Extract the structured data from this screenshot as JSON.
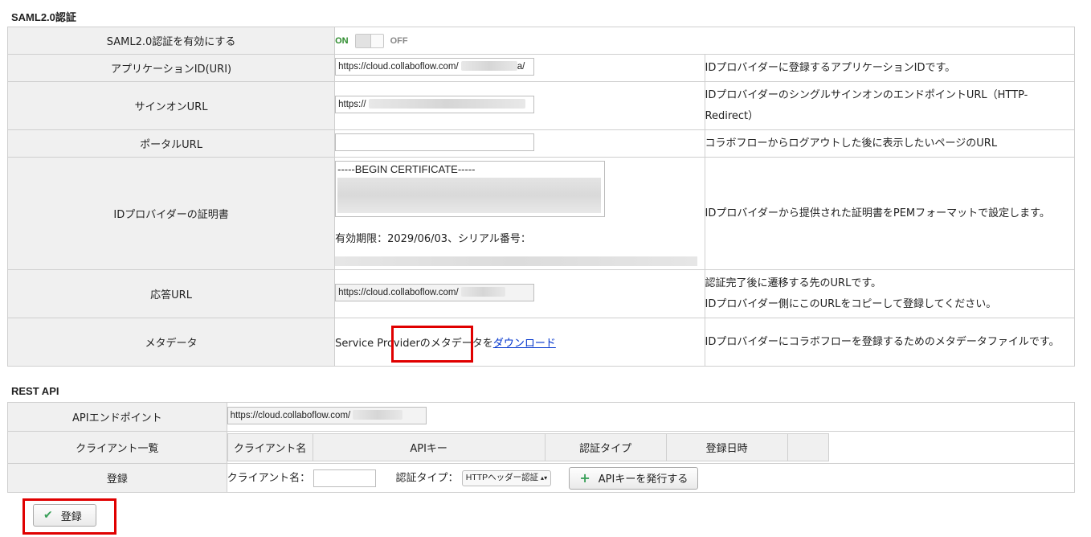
{
  "saml": {
    "title": "SAML2.0認証",
    "enable": {
      "label": "SAML2.0認証を有効にする",
      "on": "ON",
      "off": "OFF"
    },
    "app_id": {
      "label": "アプリケーションID(URI)",
      "value": "https://cloud.collaboflow.com/",
      "value_tail": "a/",
      "desc": "IDプロバイダーに登録するアプリケーションIDです。"
    },
    "signon": {
      "label": "サインオンURL",
      "value": "https://",
      "desc": "IDプロバイダーのシングルサインオンのエンドポイントURL（HTTP-Redirect）"
    },
    "portal": {
      "label": "ポータルURL",
      "value": "",
      "desc": "コラボフローからログアウトした後に表示したいページのURL"
    },
    "cert": {
      "label": "IDプロバイダーの証明書",
      "value": "-----BEGIN CERTIFICATE-----",
      "validity": "有効期限：2029/06/03、シリアル番号：",
      "desc": "IDプロバイダーから提供された証明書をPEMフォーマットで設定します。"
    },
    "response": {
      "label": "応答URL",
      "value": "https://cloud.collaboflow.com/",
      "desc1": "認証完了後に遷移する先のURLです。",
      "desc2": "IDプロバイダー側にこのURLをコピーして登録してください。"
    },
    "metadata": {
      "label": "メタデータ",
      "text": "Service Providerのメタデータを",
      "link": "ダウンロード",
      "desc": "IDプロバイダーにコラボフローを登録するためのメタデータファイルです。"
    }
  },
  "rest": {
    "title": "REST API",
    "endpoint": {
      "label": "APIエンドポイント",
      "value": "https://cloud.collaboflow.com/"
    },
    "clients": {
      "label": "クライアント一覧",
      "headers": [
        "クライアント名",
        "APIキー",
        "認証タイプ",
        "登録日時",
        ""
      ]
    },
    "register": {
      "label": "登録",
      "client_name_label": "クライアント名：",
      "auth_type_label": "認証タイプ：",
      "auth_type_value": "HTTPヘッダー認証",
      "issue_button": "APIキーを発行する"
    }
  },
  "footer": {
    "submit_button": "登録"
  }
}
